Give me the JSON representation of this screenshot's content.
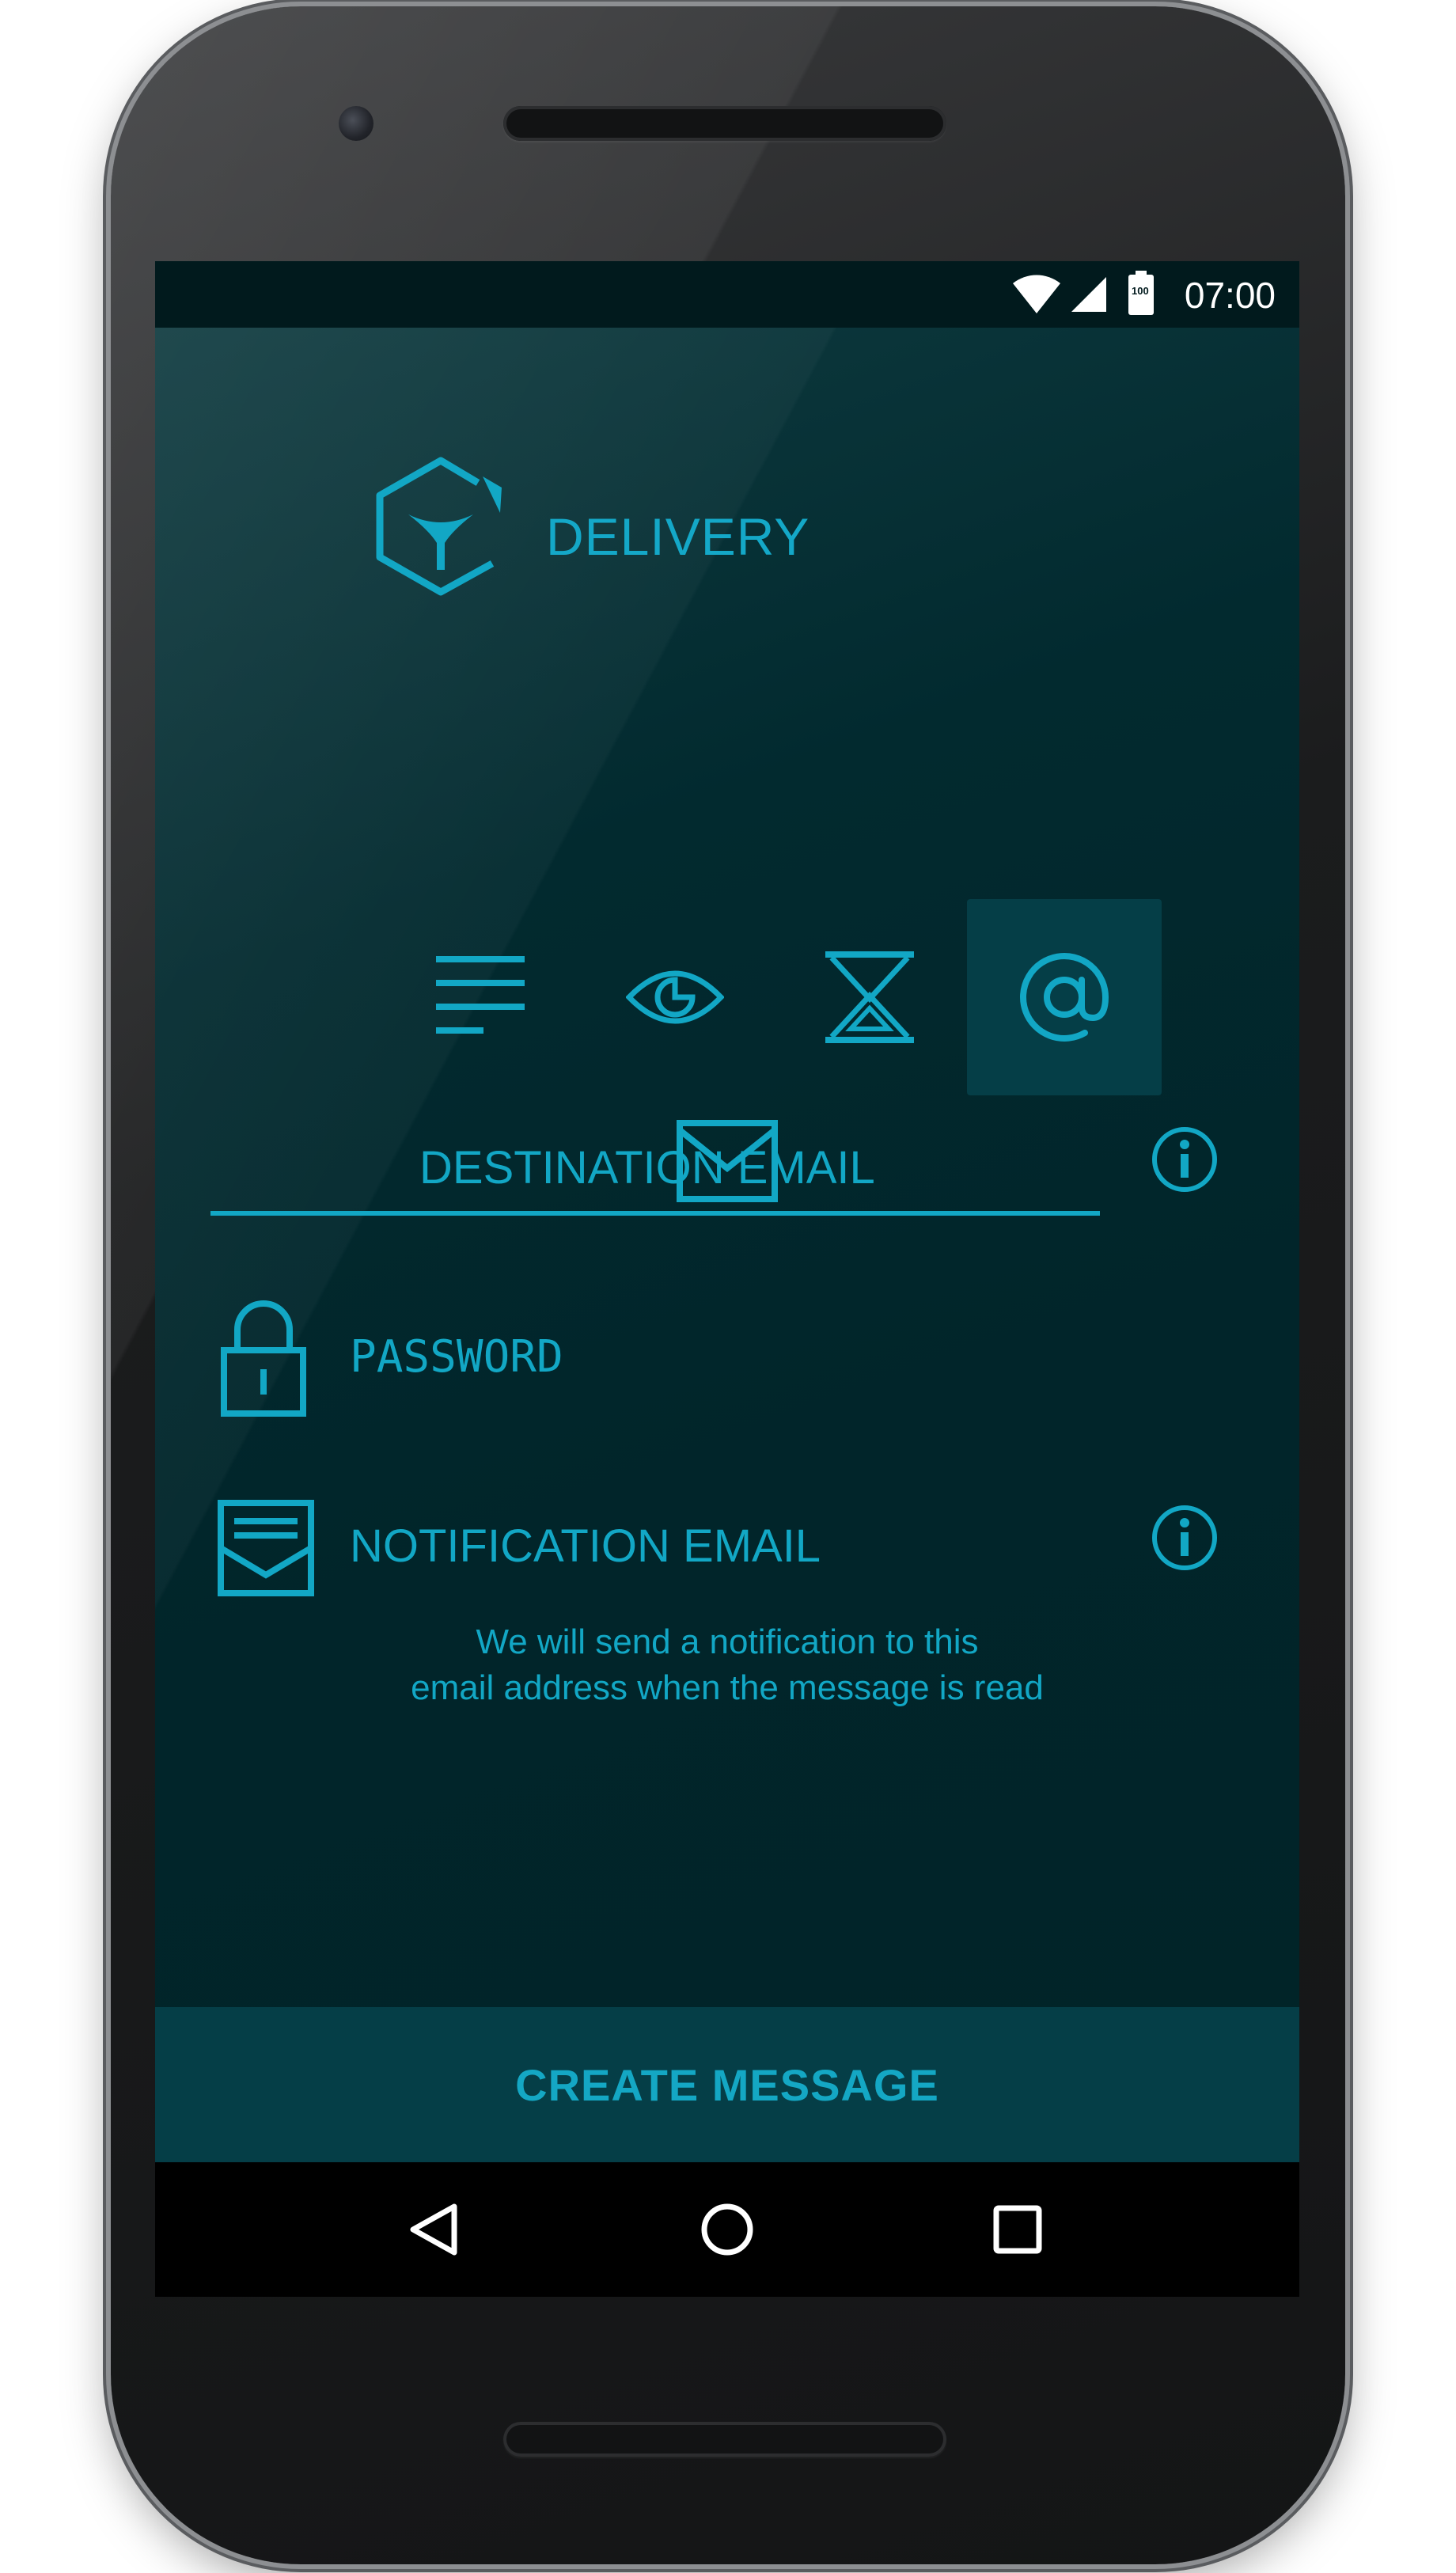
{
  "status_bar": {
    "time": "07:00",
    "battery_level": "100",
    "icons": [
      "wifi-icon",
      "signal-icon",
      "battery-icon"
    ]
  },
  "header": {
    "logo_icon": "hexagon-logo-icon",
    "title": "DELIVERY"
  },
  "tabs": [
    {
      "icon": "lines-icon",
      "active": false
    },
    {
      "icon": "eye-icon",
      "active": false
    },
    {
      "icon": "hourglass-icon",
      "active": false
    },
    {
      "icon": "at-sign-icon",
      "active": true
    }
  ],
  "destination": {
    "icon": "envelope-icon",
    "placeholder": "DESTINATION EMAIL",
    "info_icon": "info-icon"
  },
  "password": {
    "icon": "lock-icon",
    "label": "PASSWORD"
  },
  "notification": {
    "icon": "open-envelope-icon",
    "label": "NOTIFICATION EMAIL",
    "info_icon": "info-icon",
    "hint_line1": "We will send a notification to this",
    "hint_line2": "email address when the message is read"
  },
  "create_button": {
    "label": "CREATE MESSAGE"
  },
  "nav_bar": {
    "items": [
      "back-icon",
      "home-icon",
      "recents-icon"
    ]
  },
  "colors": {
    "accent": "#12a7c5",
    "background": "#012428",
    "active_tab": "#053e47",
    "button": "#053e47"
  }
}
